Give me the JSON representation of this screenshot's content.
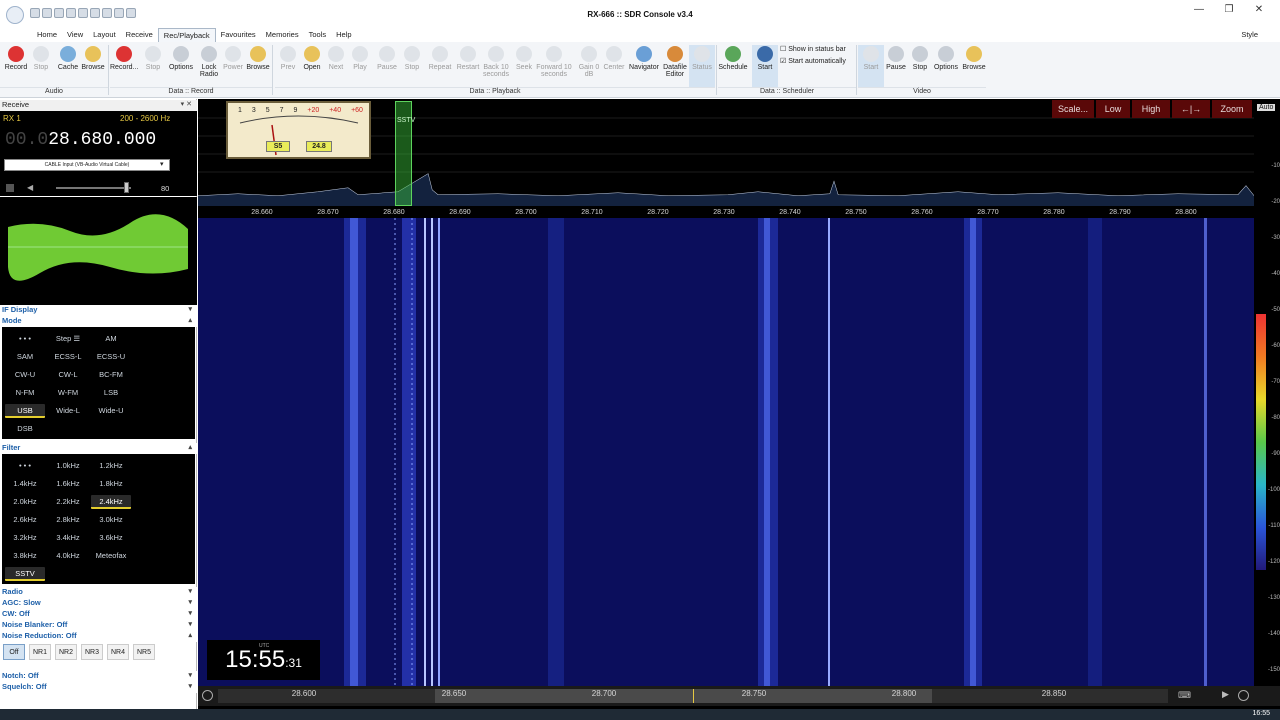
{
  "window": {
    "title": "RX-666 :: SDR Console v3.4"
  },
  "menu": {
    "items": [
      "Home",
      "View",
      "Layout",
      "Receive",
      "Rec/Playback",
      "Favourites",
      "Memories",
      "Tools",
      "Help"
    ],
    "active": "Rec/Playback",
    "style_label": "Style"
  },
  "ribbon": {
    "record_group": {
      "buttons": [
        "Record",
        "Stop",
        "Cache",
        "Browse"
      ],
      "label": "Audio"
    },
    "data_record": {
      "buttons": [
        "Record...",
        "Stop",
        "Options",
        "Lock\nRadio",
        "Power",
        "Browse"
      ],
      "label": "Data :: Record"
    },
    "data_playback": {
      "buttons": [
        "Prev",
        "Open",
        "Next",
        "Play",
        "Pause",
        "Stop",
        "Repeat",
        "Restart",
        "Back 10\nseconds",
        "Seek",
        "Forward 10\nseconds",
        "Gain 0\ndB",
        "Center",
        "Navigator",
        "Datafile\nEditor",
        "Status"
      ],
      "label": "Data :: Playback"
    },
    "scheduler": {
      "buttons": [
        "Schedule",
        "Start"
      ],
      "checks": [
        "Show in status bar",
        "Start automatically"
      ],
      "label": "Data :: Scheduler"
    },
    "video": {
      "buttons": [
        "Start",
        "Pause",
        "Stop",
        "Options",
        "Browse"
      ],
      "label": "Video"
    }
  },
  "left": {
    "receive_title": "Receive",
    "rx_label": "RX 1",
    "bandwidth": "200 - 2600 Hz",
    "freq_dim": "00.0",
    "freq_main": "28.680.000",
    "audio_device": "CABLE Input (VB-Audio Virtual Cable)",
    "volume": "80",
    "if_display": "IF Display",
    "mode_title": "Mode",
    "modes": [
      "• • •",
      "Step ☰",
      "AM",
      "SAM",
      "ECSS-L",
      "ECSS-U",
      "CW-U",
      "CW-L",
      "BC-FM",
      "N-FM",
      "W-FM",
      "LSB",
      "USB",
      "Wide-L",
      "Wide-U",
      "DSB"
    ],
    "mode_selected": "USB",
    "filter_title": "Filter",
    "filters": [
      "• • •",
      "1.0kHz",
      "1.2kHz",
      "1.4kHz",
      "1.6kHz",
      "1.8kHz",
      "2.0kHz",
      "2.2kHz",
      "2.4kHz",
      "2.6kHz",
      "2.8kHz",
      "3.0kHz",
      "3.2kHz",
      "3.4kHz",
      "3.6kHz",
      "3.8kHz",
      "4.0kHz",
      "Meteofax"
    ],
    "filter_selected": "2.4kHz",
    "sstv": "SSTV",
    "radio": "Radio",
    "agc": "AGC: Slow",
    "cw": "CW: Off",
    "noise_blanker": "Noise Blanker: Off",
    "noise_reduction": "Noise Reduction: Off",
    "nr_buttons": [
      "Off",
      "NR1",
      "NR2",
      "NR3",
      "NR4",
      "NR5"
    ],
    "notch": "Notch: Off",
    "squelch": "Squelch: Off"
  },
  "spectrum": {
    "buttons": [
      "Scale...",
      "Low",
      "High",
      "←|→",
      "Zoom"
    ],
    "auto": "Auto",
    "sstv_marker": "SSTV",
    "ticks": [
      "28.660",
      "28.670",
      "28.680",
      "28.690",
      "28.700",
      "28.710",
      "28.720",
      "28.730",
      "28.740",
      "28.750",
      "28.760",
      "28.770",
      "28.780",
      "28.790",
      "28.800"
    ],
    "s_reading": "S5",
    "db_reading": "24.8",
    "meter_scale": [
      "1",
      "3",
      "5",
      "7",
      "9",
      "+20",
      "+40",
      "+60"
    ]
  },
  "right_scale": [
    "-10",
    "-20",
    "-30",
    "-40",
    "-50",
    "-60",
    "-70",
    "-80",
    "-90",
    "-100",
    "-110",
    "-120",
    "-130",
    "-140",
    "-150"
  ],
  "clock": {
    "utc": "UTC",
    "hhmm": "15:55",
    "ss": ":31"
  },
  "bottom_scale": [
    "28.600",
    "28.650",
    "28.700",
    "28.750",
    "28.800",
    "28.850"
  ],
  "taskbar": {
    "time": "16:55"
  }
}
